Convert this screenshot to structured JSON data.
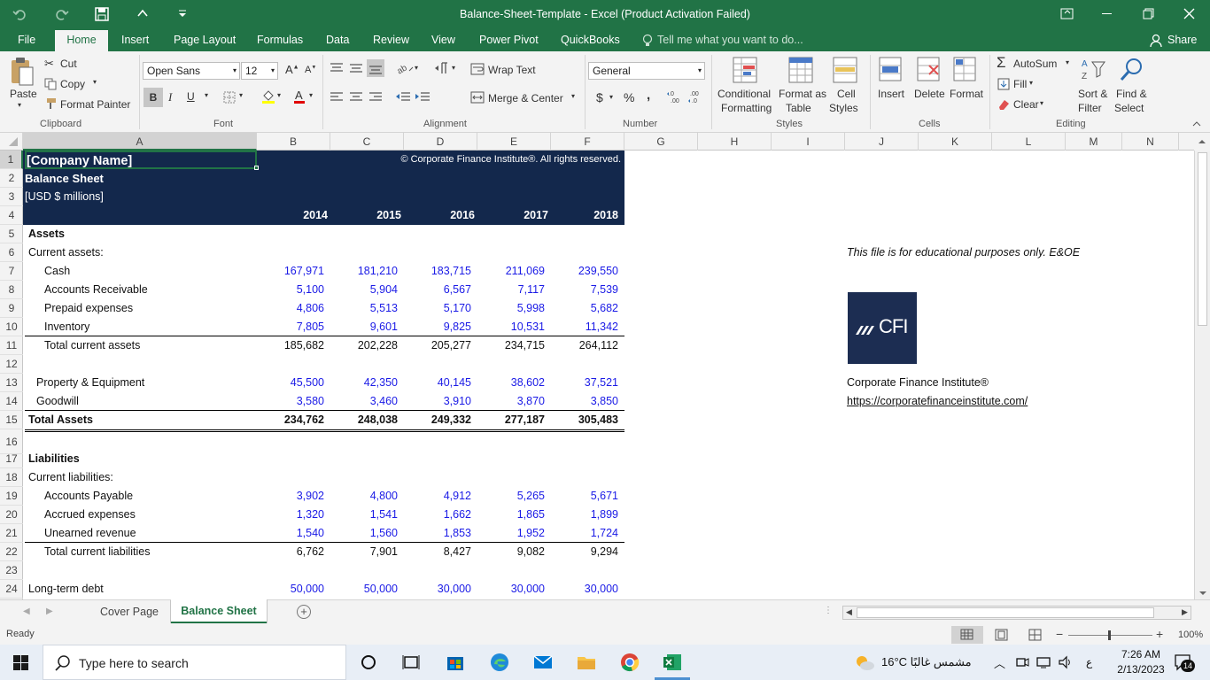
{
  "window": {
    "title": "Balance-Sheet-Template - Excel (Product Activation Failed)",
    "share_label": "Share"
  },
  "ribbon_tabs": [
    "File",
    "Home",
    "Insert",
    "Page Layout",
    "Formulas",
    "Data",
    "Review",
    "View",
    "Power Pivot",
    "QuickBooks"
  ],
  "tell_me": "Tell me what you want to do...",
  "clipboard": {
    "paste": "Paste",
    "cut": "Cut",
    "copy": "Copy",
    "format_painter": "Format Painter",
    "group": "Clipboard"
  },
  "font": {
    "name": "Open Sans",
    "size": "12",
    "bold": "B",
    "italic": "I",
    "underline": "U",
    "group": "Font"
  },
  "alignment": {
    "wrap_text": "Wrap Text",
    "merge_center": "Merge & Center",
    "group": "Alignment"
  },
  "number": {
    "format": "General",
    "currency": "$",
    "percent": "%",
    "comma": ",",
    "group": "Number"
  },
  "styles": {
    "conditional_1": "Conditional",
    "conditional_2": "Formatting",
    "format_as_1": "Format as",
    "format_as_2": "Table",
    "cell_styles_1": "Cell",
    "cell_styles_2": "Styles",
    "group": "Styles"
  },
  "cells": {
    "insert": "Insert",
    "delete": "Delete",
    "format": "Format",
    "group": "Cells"
  },
  "editing": {
    "autosum": "AutoSum",
    "fill": "Fill",
    "clear": "Clear",
    "sort_1": "Sort &",
    "sort_2": "Filter",
    "find_1": "Find &",
    "find_2": "Select",
    "group": "Editing"
  },
  "columns": [
    "A",
    "B",
    "C",
    "D",
    "E",
    "F",
    "G",
    "H",
    "I",
    "J",
    "K",
    "L",
    "M",
    "N"
  ],
  "rows": [
    "1",
    "2",
    "3",
    "4",
    "5",
    "6",
    "7",
    "8",
    "9",
    "10",
    "11",
    "12",
    "13",
    "14",
    "15",
    "16",
    "17",
    "18",
    "19",
    "20",
    "21",
    "22",
    "23",
    "24"
  ],
  "sheet": {
    "company": "[Company Name]",
    "copyright": "© Corporate Finance Institute®. All rights reserved.",
    "title": "Balance Sheet",
    "units": "[USD $ millions]",
    "years": [
      "2014",
      "2015",
      "2016",
      "2017",
      "2018"
    ],
    "assets_header": "Assets",
    "current_assets": "Current assets:",
    "cash": {
      "label": "Cash",
      "values": [
        "167,971",
        "181,210",
        "183,715",
        "211,069",
        "239,550"
      ]
    },
    "receivable": {
      "label": "Accounts Receivable",
      "values": [
        "5,100",
        "5,904",
        "6,567",
        "7,117",
        "7,539"
      ]
    },
    "prepaid": {
      "label": "Prepaid expenses",
      "values": [
        "4,806",
        "5,513",
        "5,170",
        "5,998",
        "5,682"
      ]
    },
    "inventory": {
      "label": "Inventory",
      "values": [
        "7,805",
        "9,601",
        "9,825",
        "10,531",
        "11,342"
      ]
    },
    "total_current_assets": {
      "label": "Total current assets",
      "values": [
        "185,682",
        "202,228",
        "205,277",
        "234,715",
        "264,112"
      ]
    },
    "ppe": {
      "label": "Property & Equipment",
      "values": [
        "45,500",
        "42,350",
        "40,145",
        "38,602",
        "37,521"
      ]
    },
    "goodwill": {
      "label": "Goodwill",
      "values": [
        "3,580",
        "3,460",
        "3,910",
        "3,870",
        "3,850"
      ]
    },
    "total_assets": {
      "label": "Total Assets",
      "values": [
        "234,762",
        "248,038",
        "249,332",
        "277,187",
        "305,483"
      ]
    },
    "liabilities_header": "Liabilities",
    "current_liabilities": "Current liabilities:",
    "payable": {
      "label": "Accounts Payable",
      "values": [
        "3,902",
        "4,800",
        "4,912",
        "5,265",
        "5,671"
      ]
    },
    "accrued": {
      "label": "Accrued expenses",
      "values": [
        "1,320",
        "1,541",
        "1,662",
        "1,865",
        "1,899"
      ]
    },
    "unearned": {
      "label": "Unearned revenue",
      "values": [
        "1,540",
        "1,560",
        "1,853",
        "1,952",
        "1,724"
      ]
    },
    "total_current_liabilities": {
      "label": "Total current liabilities",
      "values": [
        "6,762",
        "7,901",
        "8,427",
        "9,082",
        "9,294"
      ]
    },
    "lt_debt": {
      "label": "Long-term debt",
      "values": [
        "50,000",
        "50,000",
        "30,000",
        "30,000",
        "30,000"
      ]
    },
    "disclaimer": "This file is for educational purposes only. E&OE",
    "cfi_logo": "CFI",
    "cfi_name": "Corporate Finance Institute®",
    "cfi_url": "https://corporatefinanceinstitute.com/"
  },
  "sheet_tabs": [
    "Cover Page",
    "Balance Sheet"
  ],
  "status": {
    "ready": "Ready",
    "zoom": "100%"
  },
  "taskbar": {
    "search": "Type here to search",
    "weather": "16°C  مشمس غالبًا",
    "time": "7:26 AM",
    "date": "2/13/2023",
    "lang": "ع",
    "notif": "14"
  },
  "colors": {
    "excel_green": "#217346",
    "navy": "#13284c",
    "input_blue": "#1a1ae6"
  }
}
